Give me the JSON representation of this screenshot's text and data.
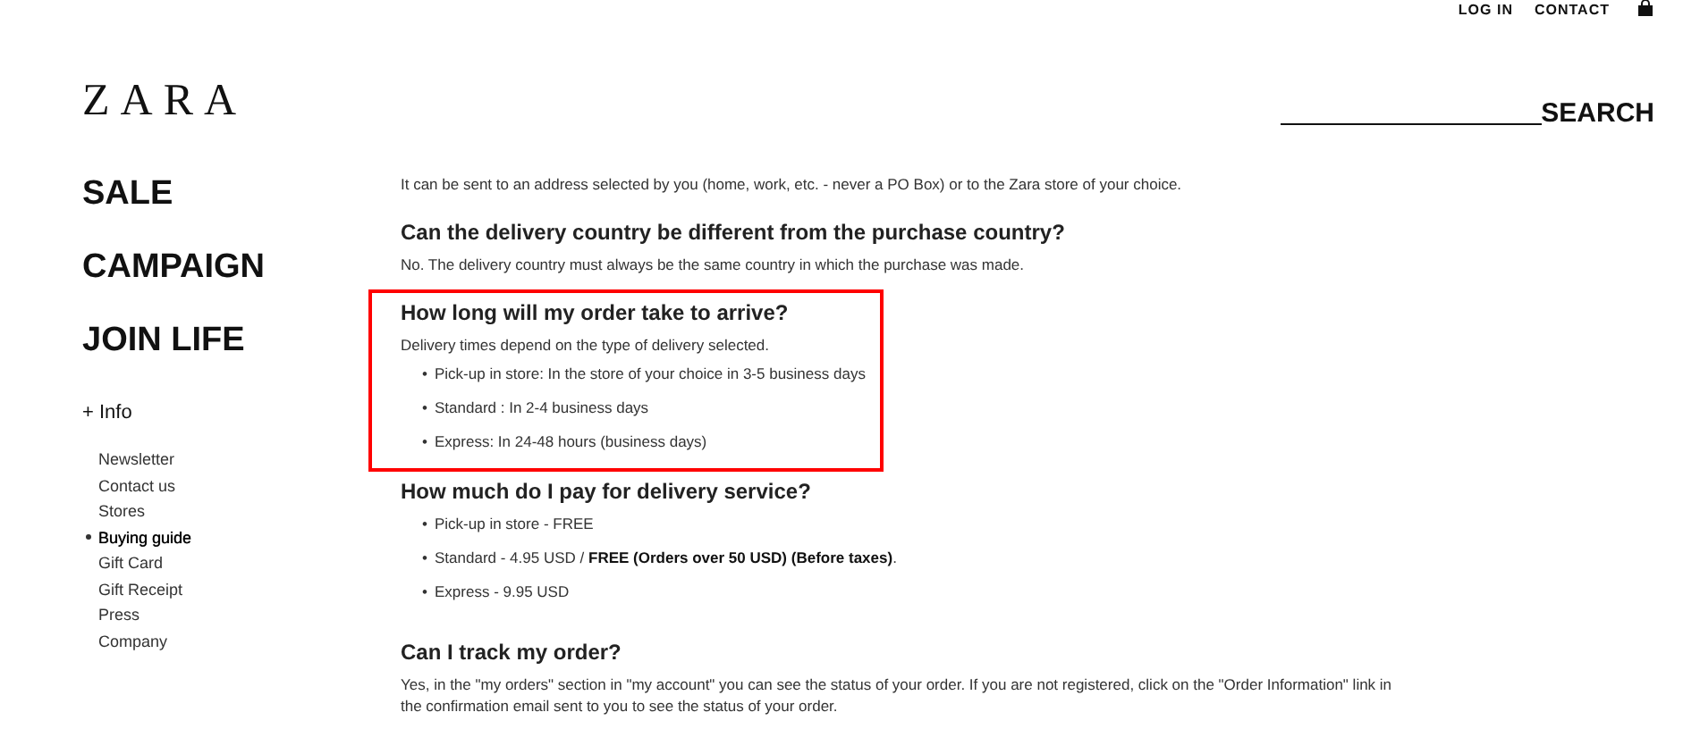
{
  "top_links": [
    "LOG IN",
    "CONTACT"
  ],
  "logo": "ZARA",
  "search": {
    "label": "SEARCH"
  },
  "nav": [
    "SALE",
    "CAMPAIGN",
    "JOIN LIFE"
  ],
  "info": {
    "label": "+ Info",
    "items": [
      {
        "label": "Newsletter",
        "selected": false
      },
      {
        "label": "Contact us",
        "selected": false
      },
      {
        "label": "Stores",
        "selected": false
      },
      {
        "label": "Buying guide",
        "selected": true
      },
      {
        "label": "Gift Card",
        "selected": false
      },
      {
        "label": "Gift Receipt",
        "selected": false
      },
      {
        "label": "Press",
        "selected": false
      },
      {
        "label": "Company",
        "selected": false
      }
    ]
  },
  "sections": [
    {
      "body": [
        "It can be sent to an address selected by you (home, work, etc. - never a PO Box) or to the Zara store of your choice."
      ],
      "highlighted": false
    },
    {
      "heading": "Can the delivery country be different from the purchase country?",
      "body": [
        "No. The delivery country must always be the same country in which the purchase was made."
      ],
      "highlighted": false
    },
    {
      "heading": "How long will my order take to arrive?",
      "body": [
        "Delivery times depend on the type of delivery selected."
      ],
      "bullets": [
        "Pick-up in store: In the store of your choice in 3-5 business days",
        "Standard : In 2-4 business days",
        "Express: In 24-48 hours (business days)"
      ],
      "marker": "•",
      "highlighted": true
    },
    {
      "heading": "How much do I pay for delivery service?",
      "bullets": [
        "Pick-up in store - FREE",
        "Standard - 4.95 USD / **FREE (Orders over 50 USD) (Before taxes)**.",
        "Express - 9.95 USD"
      ],
      "marker": "•",
      "highlighted": false
    },
    {
      "heading": "Can I track my order?",
      "body": [
        "Yes, in the \"my orders\" section in \"my account\" you can see the status of your order. If you are not registered, click on the \"Order Information\" link in the confirmation email sent to you to see the status of your order."
      ],
      "highlighted": false
    }
  ]
}
